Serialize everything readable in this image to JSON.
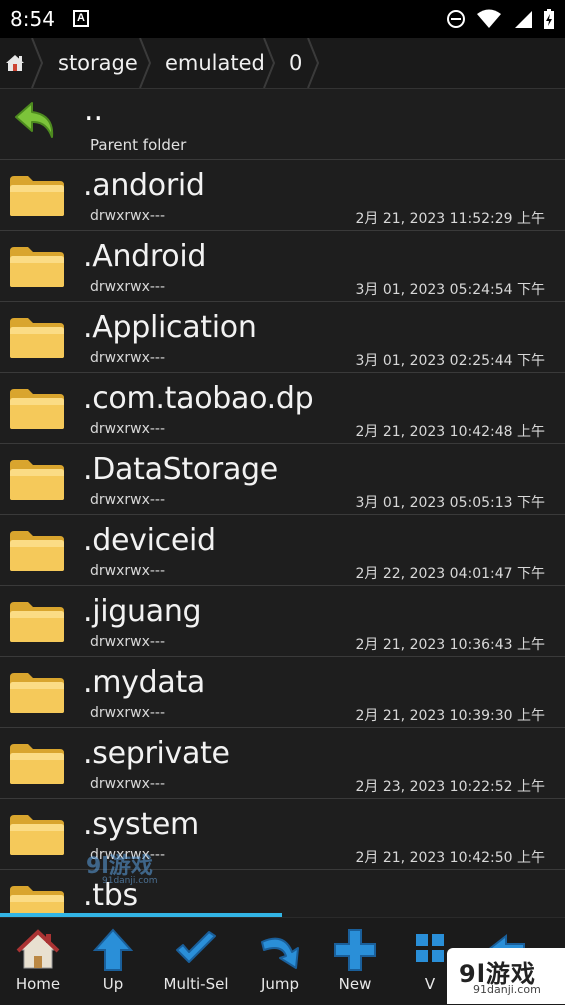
{
  "status_bar": {
    "time": "8:54",
    "a_badge": "A"
  },
  "breadcrumb": {
    "items": [
      "storage",
      "emulated",
      "0"
    ]
  },
  "parent": {
    "dots": "..",
    "label": "Parent folder"
  },
  "files": [
    {
      "name": ".andorid",
      "perm": "drwxrwx---",
      "date": "2月 21, 2023 11:52:29 上午"
    },
    {
      "name": ".Android",
      "perm": "drwxrwx---",
      "date": "3月 01, 2023 05:24:54 下午"
    },
    {
      "name": ".Application",
      "perm": "drwxrwx---",
      "date": "3月 01, 2023 02:25:44 下午"
    },
    {
      "name": ".com.taobao.dp",
      "perm": "drwxrwx---",
      "date": "2月 21, 2023 10:42:48 上午"
    },
    {
      "name": ".DataStorage",
      "perm": "drwxrwx---",
      "date": "3月 01, 2023 05:05:13 下午"
    },
    {
      "name": ".deviceid",
      "perm": "drwxrwx---",
      "date": "2月 22, 2023 04:01:47 下午"
    },
    {
      "name": ".jiguang",
      "perm": "drwxrwx---",
      "date": "2月 21, 2023 10:36:43 上午"
    },
    {
      "name": ".mydata",
      "perm": "drwxrwx---",
      "date": "2月 21, 2023 10:39:30 上午"
    },
    {
      "name": ".seprivate",
      "perm": "drwxrwx---",
      "date": "2月 23, 2023 10:22:52 上午"
    },
    {
      "name": ".system",
      "perm": "drwxrwx---",
      "date": "2月 21, 2023 10:42:50 上午"
    },
    {
      "name": ".tbs",
      "perm": "",
      "date": ""
    }
  ],
  "toolbar": {
    "home": "Home",
    "up": "Up",
    "multisel": "Multi-Sel",
    "jump": "Jump",
    "new": "New",
    "view": "V"
  },
  "watermark": {
    "main": "9l游戏",
    "sub": "91danji.com"
  },
  "colors": {
    "accent": "#33b5e5",
    "folder": "#f2c14e",
    "row_bg": "#1e1e1e"
  }
}
